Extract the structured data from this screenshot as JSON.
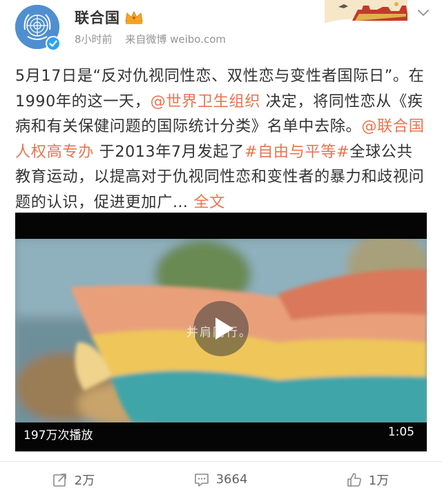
{
  "account": {
    "name": "联合国",
    "time": "8小时前",
    "source": "来自微博 weibo.com"
  },
  "post": {
    "t1": "5月17日是“反对仇视同性恋、双性恋与变性者国际日”。在1990年的这一天，",
    "mention_who": "@世界卫生组织",
    "t2": " 决定，将同性恋从《疾病和有关保健问题的国际统计分类》名单中去除。",
    "mention_ohchr": "@联合国人权高专办",
    "t3": " 于2013年7月发起了",
    "hashtag": "#自由与平等#",
    "t4": "全球公共教育运动，以提高对于仇视同性恋和变性者的暴力和歧视问题的认识，促进更加广… ",
    "more": "全文"
  },
  "video": {
    "caption": "并肩同行。",
    "plays": "197万次播放",
    "duration": "1:05"
  },
  "actions": {
    "repost": "2万",
    "comment": "3664",
    "like": "1万"
  },
  "colors": {
    "link": "#eb7350",
    "meta": "#939393",
    "verified": "#2ba3f5"
  }
}
